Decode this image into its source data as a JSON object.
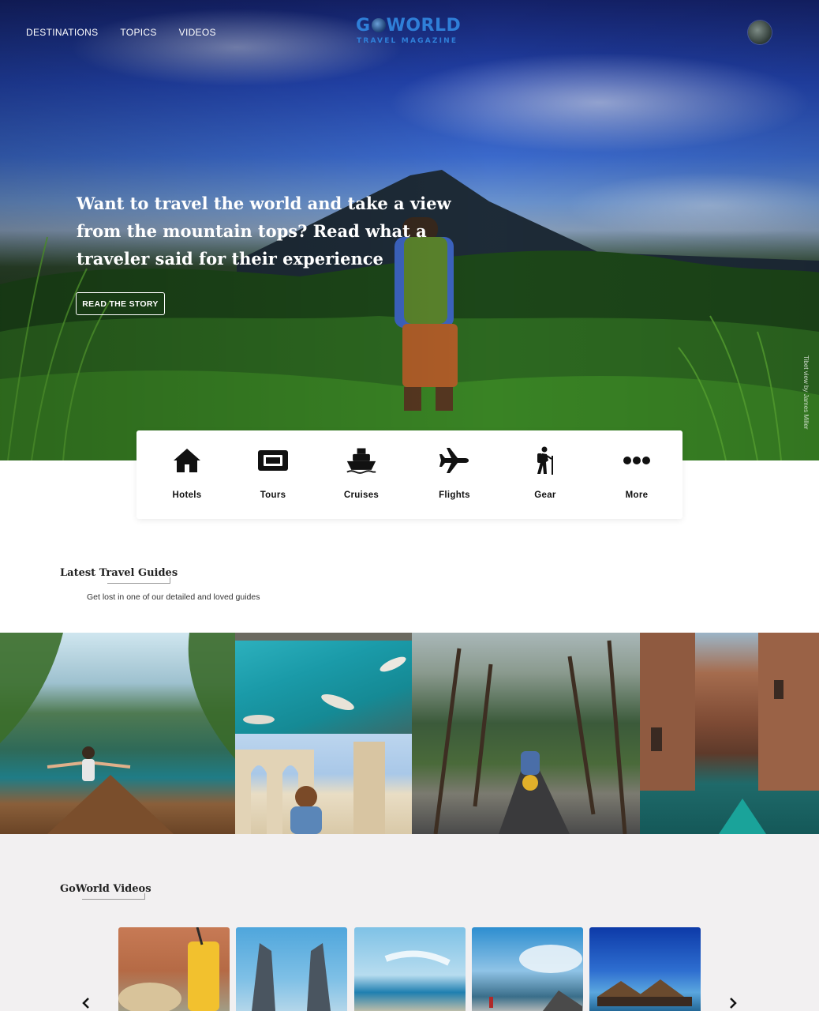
{
  "nav": {
    "items": [
      "DESTINATIONS",
      "TOPICS",
      "VIDEOS"
    ]
  },
  "logo": {
    "word_part1": "G",
    "word_part2": "WORLD",
    "sub": "TRAVEL MAGAZINE"
  },
  "hero": {
    "headline": "Want to travel the world and take a view from the mountain tops? Read what a traveler said for their experience",
    "cta_label": "READ THE STORY",
    "photo_credit": "Tibet view by James Miller"
  },
  "categories": [
    {
      "label": "Hotels",
      "icon": "house-icon"
    },
    {
      "label": "Tours",
      "icon": "ticket-icon"
    },
    {
      "label": "Cruises",
      "icon": "ship-icon"
    },
    {
      "label": "Flights",
      "icon": "airplane-icon"
    },
    {
      "label": "Gear",
      "icon": "hiker-icon"
    },
    {
      "label": "More",
      "icon": "more-dots-icon"
    }
  ],
  "guides": {
    "title": "Latest Travel Guides",
    "subtitle": "Get lost in one of our detailed and loved guides"
  },
  "videos": {
    "title": "GoWorld Videos",
    "prev_icon": "chevron-left-icon",
    "next_icon": "chevron-right-icon"
  },
  "colors": {
    "brand": "#2f7fd8",
    "videos_bg": "#f2f0f1"
  }
}
